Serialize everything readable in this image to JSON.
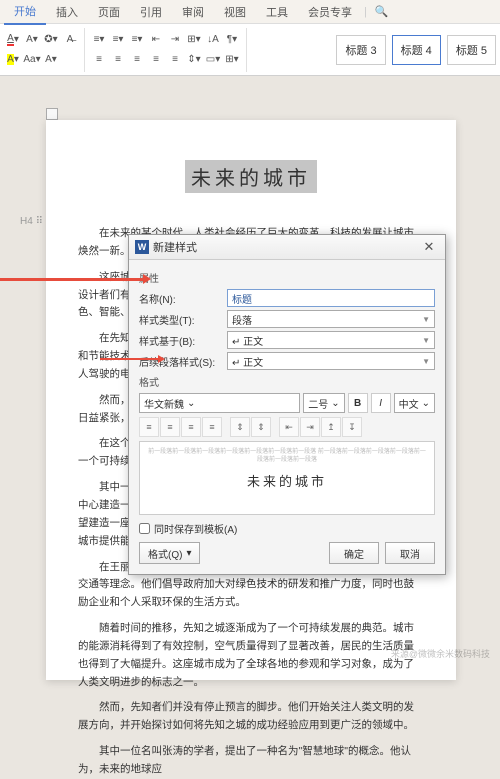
{
  "tabs": {
    "start": "开始",
    "insert": "插入",
    "page": "页面",
    "ref": "引用",
    "review": "审阅",
    "view": "视图",
    "tools": "工具",
    "member": "会员专享"
  },
  "styles": {
    "h3": "标题 3",
    "h4": "标题 4",
    "h5": "标题 5"
  },
  "doc": {
    "title": "未来的城市",
    "p1": "在未来的某个时代，人类社会经历了巨大的变革，科技的发展让城市焕然一新。在这个城市中，有一座独特的建筑吸引了所有人的目光。",
    "p2": "这座城市叫做\"先知之城\"，它坐落在一片被群山环绕的盆地中，城市的设计者们有着远见卓识的眼光，将环保与科技完美融合，打造出一个绿色、智能、宜居的城市，塑造未来的生活方式。",
    "p3": "在先知之城中，处处可见绿色建筑，这些建筑采用了先进的环保材料和节能技术，以满足居民的舒适需求。城市中的交通系统也十分先进，无人驾驶的电动汽车和飞行器构成为主要的交通工具。",
    "p4": "然而，随着城市的发展，问题也逐渐浮现。能源消耗越来越大，资源日益紧张，空气质量逐渐恶化。",
    "p5": "在这个时候，一位名叫王丽的年轻科学家站了出来。她深知城市需要一个可持续的发展方向，并开始研究解决方案。",
    "p6": "其中一位名叫李明的建筑师，提出了一个大胆的方案。他建议在城市中心建造一座城市应该像一棵大树一样生长，根深叶茂，自给自足。他希望建造一座生态建筑，既像树一样有机地生长，又能吸收阳光和雨水，为城市提供能源和水资源，同时还能以保持自身的生长需求。",
    "p7": "在王丽的带领下，先知者们开始倡导绿色建筑、可再生能源和可持续交通等理念。他们倡导政府加大对绿色技术的研发和推广力度，同时也鼓励企业和个人采取环保的生活方式。",
    "p8": "随着时间的推移，先知之城逐渐成为了一个可持续发展的典范。城市的能源消耗得到了有效控制，空气质量得到了显著改善，居民的生活质量也得到了大幅提升。这座城市成为了全球各地的参观和学习对象，成为了人类文明进步的标志之一。",
    "p9": "然而，先知者们并没有停止预言的脚步。他们开始关注人类文明的发展方向，并开始探讨如何将先知之城的成功经验应用到更广泛的领域中。",
    "p10": "其中一位名叫张涛的学者，提出了一种名为\"智慧地球\"的概念。他认为，未来的地球应"
  },
  "h4": "H4",
  "dialog": {
    "title": "新建样式",
    "sect_prop": "属性",
    "name_label": "名称(N):",
    "name_value": "标题",
    "type_label": "样式类型(T):",
    "type_value": "段落",
    "base_label": "样式基于(B):",
    "base_value": "↵ 正文",
    "next_label": "后续段落样式(S):",
    "next_value": "↵ 正文",
    "sect_fmt": "格式",
    "font": "华文新魏",
    "size": "二号",
    "bold": "B",
    "italic": "I",
    "lang": "中文",
    "preview_text": "未来的城市",
    "preview_lines": "前一段落前一段落前一段落前一段落前一段落前一段落前一段落\n前一段落前一段落前一段落前一段落前一段落前一段落前一段落",
    "save_tpl": "同时保存到模板(A)",
    "fmt_btn": "格式(Q)",
    "ok": "确定",
    "cancel": "取消"
  },
  "watermark": "来源@微微余米数码科技"
}
